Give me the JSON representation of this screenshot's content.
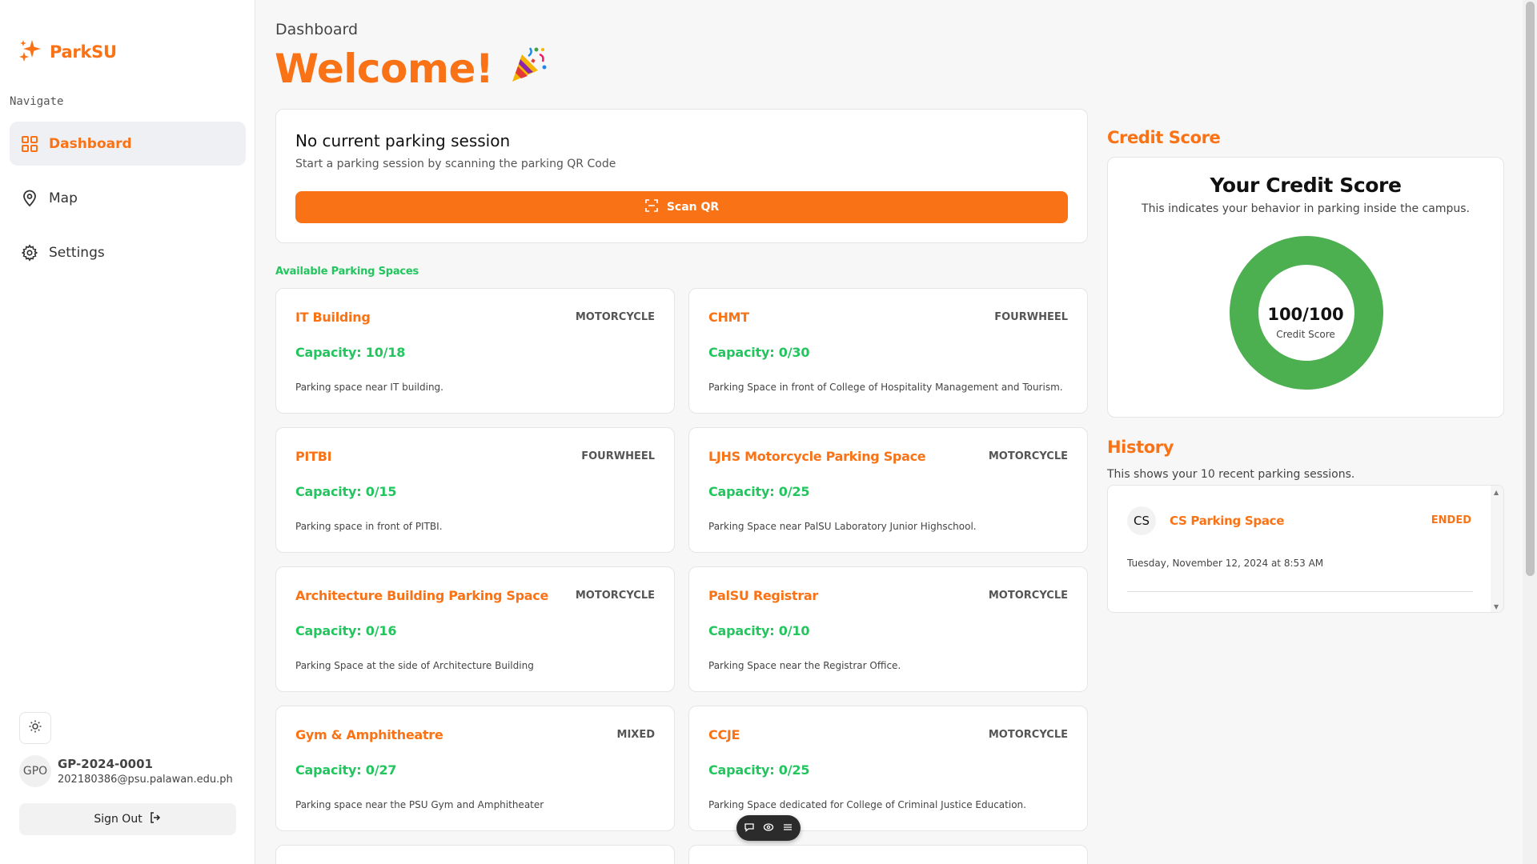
{
  "brand": {
    "name": "ParkSU"
  },
  "sidebar": {
    "nav_label": "Navigate",
    "items": [
      {
        "label": "Dashboard",
        "icon": "grid-icon",
        "active": true
      },
      {
        "label": "Map",
        "icon": "map-pin-icon",
        "active": false
      },
      {
        "label": "Settings",
        "icon": "gear-icon",
        "active": false
      }
    ],
    "user": {
      "initials": "GPO",
      "id": "GP-2024-0001",
      "email": "202180386@psu.palawan.edu.ph"
    },
    "sign_out": "Sign Out"
  },
  "header": {
    "breadcrumb": "Dashboard",
    "welcome": "Welcome!",
    "emoji": "🎉"
  },
  "session": {
    "title": "No current parking session",
    "subtitle": "Start a parking session by scanning the parking QR Code",
    "scan_label": "Scan QR"
  },
  "spaces": {
    "label": "Available Parking Spaces",
    "items": [
      {
        "name": "IT Building",
        "type": "MOTORCYCLE",
        "capacity": "Capacity: 10/18",
        "description": "Parking space near IT building."
      },
      {
        "name": "CHMT",
        "type": "FOURWHEEL",
        "capacity": "Capacity: 0/30",
        "description": "Parking Space in front of College of Hospitality Management and Tourism."
      },
      {
        "name": "PITBI",
        "type": "FOURWHEEL",
        "capacity": "Capacity: 0/15",
        "description": "Parking space in front of PITBI."
      },
      {
        "name": "LJHS Motorcycle Parking Space",
        "type": "MOTORCYCLE",
        "capacity": "Capacity: 0/25",
        "description": "Parking Space near PalSU Laboratory Junior Highschool."
      },
      {
        "name": "Architecture Building Parking Space",
        "type": "MOTORCYCLE",
        "capacity": "Capacity: 0/16",
        "description": "Parking Space at the side of Architecture Building"
      },
      {
        "name": "PalSU Registrar",
        "type": "MOTORCYCLE",
        "capacity": "Capacity: 0/10",
        "description": "Parking Space near the Registrar Office."
      },
      {
        "name": "Gym & Amphitheatre",
        "type": "MIXED",
        "capacity": "Capacity: 0/27",
        "description": "Parking space near the PSU Gym and Amphitheater"
      },
      {
        "name": "CCJE",
        "type": "MOTORCYCLE",
        "capacity": "Capacity: 0/25",
        "description": "Parking Space dedicated for College of Criminal Justice Education."
      }
    ]
  },
  "credit": {
    "section_title": "Credit Score",
    "card_title": "Your Credit Score",
    "subtitle": "This indicates your behavior in parking inside the campus.",
    "score_text": "100/100",
    "score_fraction": 1.0,
    "score_label": "Credit Score",
    "color": "#4caf50"
  },
  "history": {
    "section_title": "History",
    "subtitle": "This shows your 10 recent parking sessions.",
    "items": [
      {
        "initials": "CS",
        "name": "CS Parking Space",
        "status": "ENDED",
        "date": "Tuesday, November 12, 2024 at 8:53 AM"
      }
    ]
  },
  "colors": {
    "accent": "#f97316",
    "success": "#22c55e"
  }
}
